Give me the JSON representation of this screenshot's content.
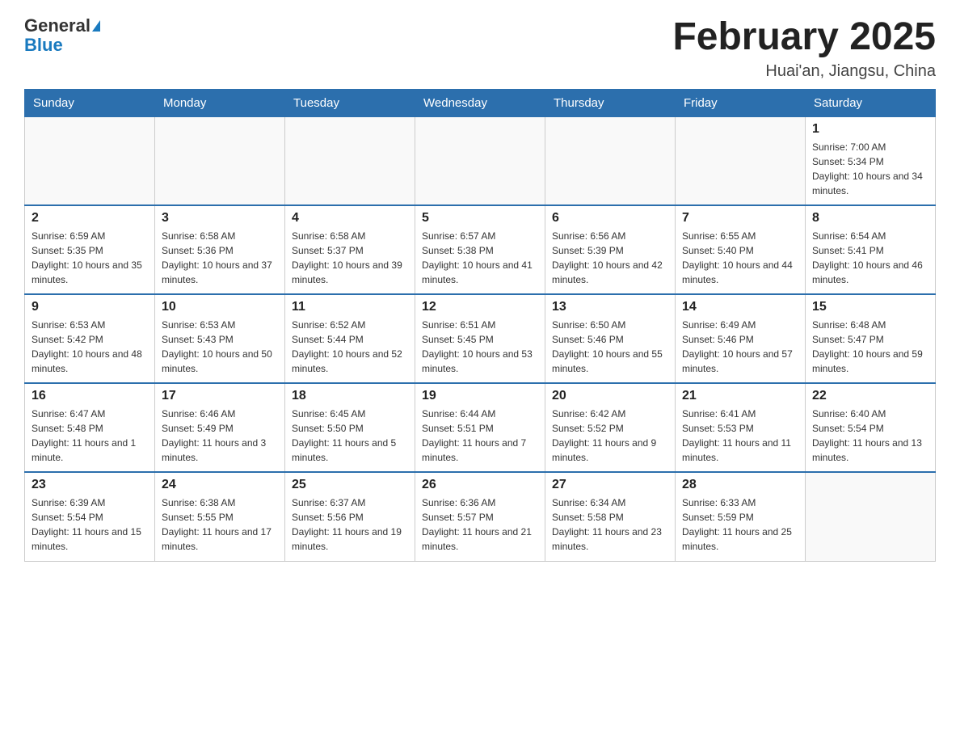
{
  "logo": {
    "general": "General",
    "blue": "Blue"
  },
  "title": "February 2025",
  "location": "Huai'an, Jiangsu, China",
  "days_of_week": [
    "Sunday",
    "Monday",
    "Tuesday",
    "Wednesday",
    "Thursday",
    "Friday",
    "Saturday"
  ],
  "weeks": [
    [
      {
        "day": "",
        "info": ""
      },
      {
        "day": "",
        "info": ""
      },
      {
        "day": "",
        "info": ""
      },
      {
        "day": "",
        "info": ""
      },
      {
        "day": "",
        "info": ""
      },
      {
        "day": "",
        "info": ""
      },
      {
        "day": "1",
        "info": "Sunrise: 7:00 AM\nSunset: 5:34 PM\nDaylight: 10 hours and 34 minutes."
      }
    ],
    [
      {
        "day": "2",
        "info": "Sunrise: 6:59 AM\nSunset: 5:35 PM\nDaylight: 10 hours and 35 minutes."
      },
      {
        "day": "3",
        "info": "Sunrise: 6:58 AM\nSunset: 5:36 PM\nDaylight: 10 hours and 37 minutes."
      },
      {
        "day": "4",
        "info": "Sunrise: 6:58 AM\nSunset: 5:37 PM\nDaylight: 10 hours and 39 minutes."
      },
      {
        "day": "5",
        "info": "Sunrise: 6:57 AM\nSunset: 5:38 PM\nDaylight: 10 hours and 41 minutes."
      },
      {
        "day": "6",
        "info": "Sunrise: 6:56 AM\nSunset: 5:39 PM\nDaylight: 10 hours and 42 minutes."
      },
      {
        "day": "7",
        "info": "Sunrise: 6:55 AM\nSunset: 5:40 PM\nDaylight: 10 hours and 44 minutes."
      },
      {
        "day": "8",
        "info": "Sunrise: 6:54 AM\nSunset: 5:41 PM\nDaylight: 10 hours and 46 minutes."
      }
    ],
    [
      {
        "day": "9",
        "info": "Sunrise: 6:53 AM\nSunset: 5:42 PM\nDaylight: 10 hours and 48 minutes."
      },
      {
        "day": "10",
        "info": "Sunrise: 6:53 AM\nSunset: 5:43 PM\nDaylight: 10 hours and 50 minutes."
      },
      {
        "day": "11",
        "info": "Sunrise: 6:52 AM\nSunset: 5:44 PM\nDaylight: 10 hours and 52 minutes."
      },
      {
        "day": "12",
        "info": "Sunrise: 6:51 AM\nSunset: 5:45 PM\nDaylight: 10 hours and 53 minutes."
      },
      {
        "day": "13",
        "info": "Sunrise: 6:50 AM\nSunset: 5:46 PM\nDaylight: 10 hours and 55 minutes."
      },
      {
        "day": "14",
        "info": "Sunrise: 6:49 AM\nSunset: 5:46 PM\nDaylight: 10 hours and 57 minutes."
      },
      {
        "day": "15",
        "info": "Sunrise: 6:48 AM\nSunset: 5:47 PM\nDaylight: 10 hours and 59 minutes."
      }
    ],
    [
      {
        "day": "16",
        "info": "Sunrise: 6:47 AM\nSunset: 5:48 PM\nDaylight: 11 hours and 1 minute."
      },
      {
        "day": "17",
        "info": "Sunrise: 6:46 AM\nSunset: 5:49 PM\nDaylight: 11 hours and 3 minutes."
      },
      {
        "day": "18",
        "info": "Sunrise: 6:45 AM\nSunset: 5:50 PM\nDaylight: 11 hours and 5 minutes."
      },
      {
        "day": "19",
        "info": "Sunrise: 6:44 AM\nSunset: 5:51 PM\nDaylight: 11 hours and 7 minutes."
      },
      {
        "day": "20",
        "info": "Sunrise: 6:42 AM\nSunset: 5:52 PM\nDaylight: 11 hours and 9 minutes."
      },
      {
        "day": "21",
        "info": "Sunrise: 6:41 AM\nSunset: 5:53 PM\nDaylight: 11 hours and 11 minutes."
      },
      {
        "day": "22",
        "info": "Sunrise: 6:40 AM\nSunset: 5:54 PM\nDaylight: 11 hours and 13 minutes."
      }
    ],
    [
      {
        "day": "23",
        "info": "Sunrise: 6:39 AM\nSunset: 5:54 PM\nDaylight: 11 hours and 15 minutes."
      },
      {
        "day": "24",
        "info": "Sunrise: 6:38 AM\nSunset: 5:55 PM\nDaylight: 11 hours and 17 minutes."
      },
      {
        "day": "25",
        "info": "Sunrise: 6:37 AM\nSunset: 5:56 PM\nDaylight: 11 hours and 19 minutes."
      },
      {
        "day": "26",
        "info": "Sunrise: 6:36 AM\nSunset: 5:57 PM\nDaylight: 11 hours and 21 minutes."
      },
      {
        "day": "27",
        "info": "Sunrise: 6:34 AM\nSunset: 5:58 PM\nDaylight: 11 hours and 23 minutes."
      },
      {
        "day": "28",
        "info": "Sunrise: 6:33 AM\nSunset: 5:59 PM\nDaylight: 11 hours and 25 minutes."
      },
      {
        "day": "",
        "info": ""
      }
    ]
  ]
}
